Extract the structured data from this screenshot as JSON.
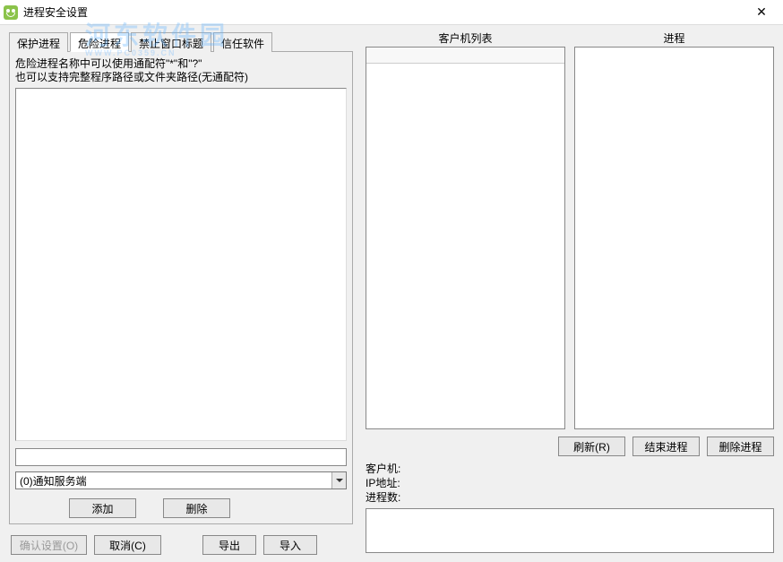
{
  "window": {
    "title": "进程安全设置"
  },
  "watermark": {
    "text": "河东软件园",
    "sub": "WWW.PC0359.CN"
  },
  "tabs": {
    "items": [
      {
        "label": "保护进程"
      },
      {
        "label": "危险进程"
      },
      {
        "label": "禁止窗口标题"
      },
      {
        "label": "信任软件"
      }
    ],
    "active_index": 1
  },
  "tabContent": {
    "hint_line1": "危险进程名称中可以使用通配符\"*\"和\"?\"",
    "hint_line2": "也可以支持完整程序路径或文件夹路径(无通配符)"
  },
  "dropdown": {
    "selected": "(0)通知服务端"
  },
  "buttons": {
    "add": "添加",
    "delete": "删除",
    "confirm": "确认设置(O)",
    "cancel": "取消(C)",
    "export": "导出",
    "import": "导入",
    "refresh": "刷新(R)",
    "end_process": "结束进程",
    "delete_process": "删除进程"
  },
  "rightPanel": {
    "client_list_header": "客户机列表",
    "process_header": "进程",
    "client_label": "客户机:",
    "ip_label": "IP地址:",
    "process_count_label": "进程数:",
    "client_value": "",
    "ip_value": "",
    "process_count_value": ""
  }
}
